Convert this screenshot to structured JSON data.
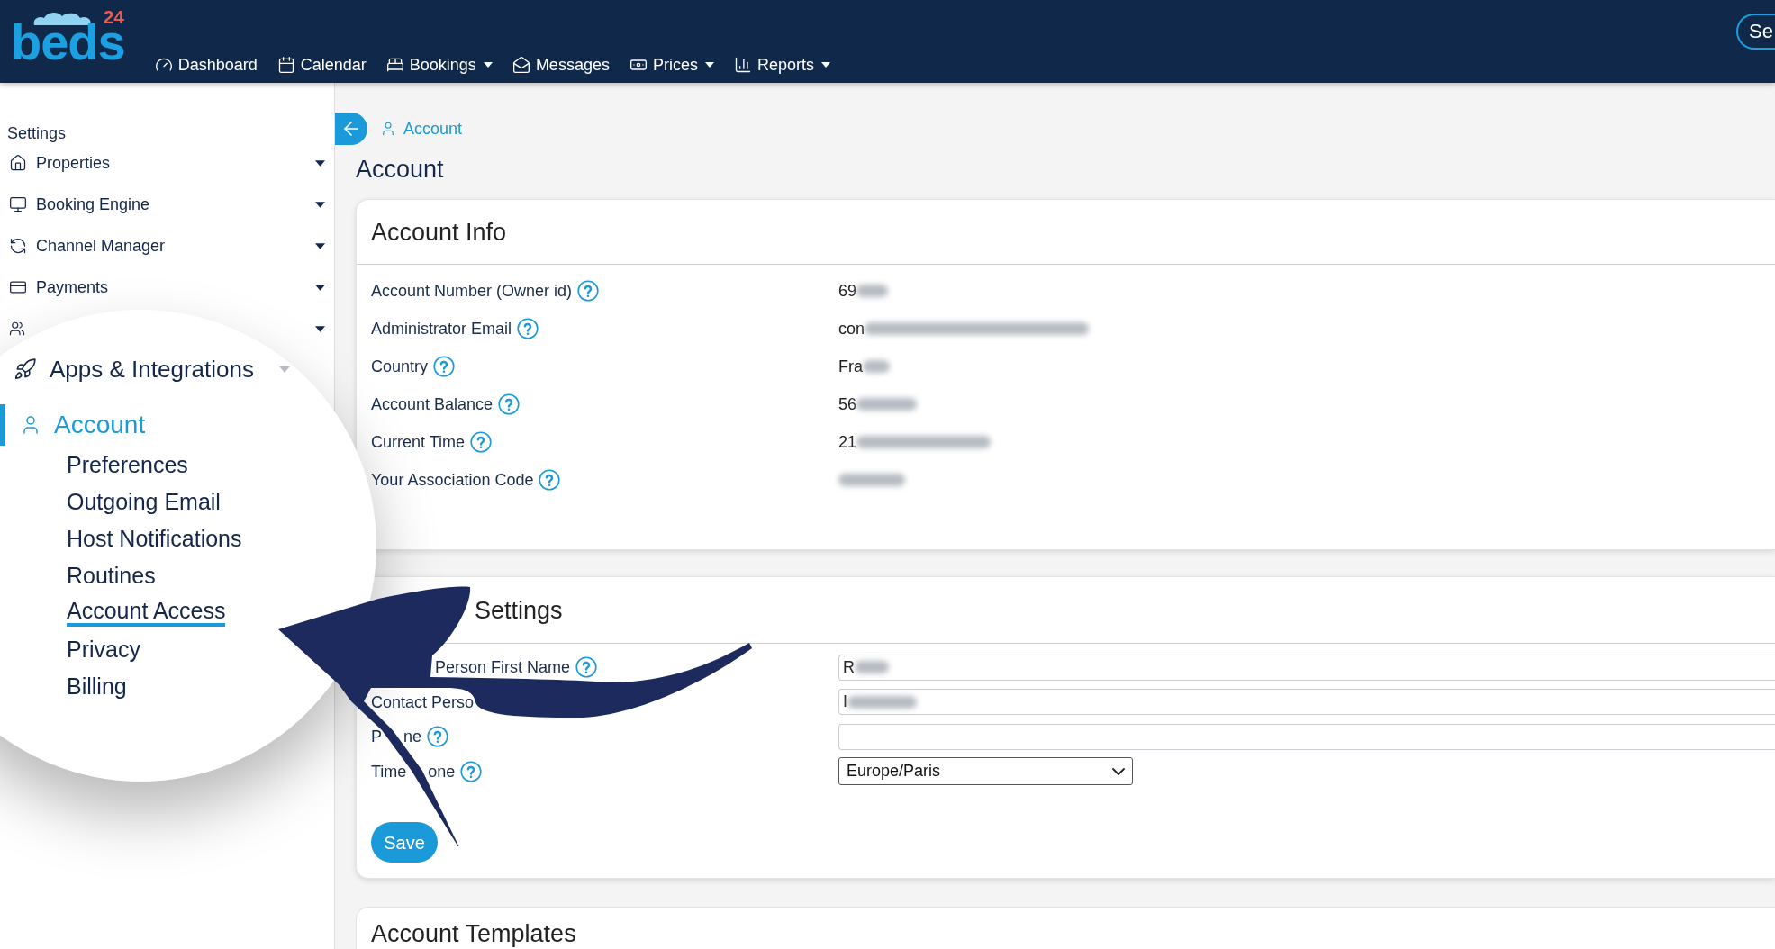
{
  "header": {
    "logo": {
      "word": "beds",
      "number": "24"
    },
    "nav": [
      {
        "label": "Dashboard",
        "dropdown": false
      },
      {
        "label": "Calendar",
        "dropdown": false
      },
      {
        "label": "Bookings",
        "dropdown": true
      },
      {
        "label": "Messages",
        "dropdown": false
      },
      {
        "label": "Prices",
        "dropdown": true
      },
      {
        "label": "Reports",
        "dropdown": true
      }
    ],
    "corner_button": {
      "label": "Se"
    }
  },
  "sidebar": {
    "title": "Settings",
    "items": [
      {
        "label": "Properties",
        "selected": false
      },
      {
        "label": "Booking Engine",
        "selected": false
      },
      {
        "label": "Channel Manager",
        "selected": false
      },
      {
        "label": "Payments",
        "selected": false
      },
      {
        "selected": false
      }
    ]
  },
  "magnifier": {
    "items": [
      {
        "label": "Apps & Integrations",
        "selected": false
      },
      {
        "label": "Account",
        "selected": true,
        "children": [
          {
            "label": "Preferences",
            "selected": false
          },
          {
            "label": "Outgoing Email",
            "selected": false
          },
          {
            "label": "Host Notifications",
            "selected": false
          },
          {
            "label": "Routines",
            "selected": false
          },
          {
            "label": "Account Access",
            "selected": true
          },
          {
            "label": "Privacy",
            "selected": false
          },
          {
            "label": "Billing",
            "selected": false
          }
        ]
      }
    ]
  },
  "breadcrumb": {
    "label": "Account"
  },
  "page_title": "Account",
  "account_info": {
    "title": "Account Info",
    "rows": [
      {
        "label": "Account Number (Owner id)",
        "value": "69",
        "redacted": true
      },
      {
        "label": "Administrator Email",
        "value": "con",
        "redacted": true
      },
      {
        "label": "Country",
        "value": "Fra",
        "redacted": true
      },
      {
        "label": "Account Balance",
        "value": "56",
        "redacted": true
      },
      {
        "label": "Current Time",
        "value": "21",
        "redacted": true
      },
      {
        "label": "Your Association Code",
        "redacted": true
      }
    ]
  },
  "account_settings": {
    "title": "Settings",
    "fields": [
      {
        "kind": "text",
        "label_parts": [
          "Person First Name"
        ],
        "help": true,
        "value": "R",
        "redacted": true
      },
      {
        "kind": "text",
        "label_parts": [
          "Contact Perso"
        ],
        "help": false,
        "value": "I",
        "redacted": true
      },
      {
        "kind": "text",
        "label_parts": [
          "P",
          "ne"
        ],
        "help": true,
        "redacted": false
      },
      {
        "kind": "select",
        "label_parts": [
          "Time",
          "one"
        ],
        "help": true,
        "value": "Europe/Paris",
        "redacted": false
      }
    ],
    "save_button": {
      "label": "Save"
    }
  },
  "account_templates": {
    "title": "Account Templates"
  }
}
